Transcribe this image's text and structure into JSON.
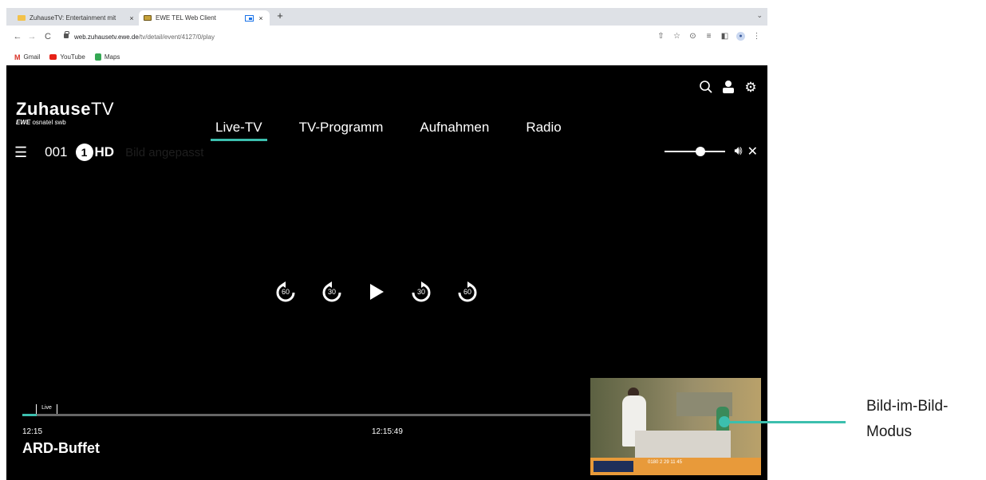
{
  "browser": {
    "tabs": [
      {
        "title": "ZuhauseTV: Entertainment mit",
        "active": false
      },
      {
        "title": "EWE TEL Web Client",
        "active": true
      }
    ],
    "new_tab": "+",
    "tab_close": "×",
    "url_host": "web.zuhausetv.ewe.de",
    "url_path": "/tv/detail/event/4127/0/play",
    "bookmarks": [
      "Gmail",
      "YouTube",
      "Maps"
    ]
  },
  "header": {
    "logo_bold": "Zuhause",
    "logo_thin": "TV",
    "logo_sub_brand": "EWE",
    "logo_sub_rest": "osnatel swb",
    "nav": [
      "Live-TV",
      "TV-Programm",
      "Aufnahmen",
      "Radio"
    ],
    "active_nav": "Live-TV"
  },
  "channel": {
    "menu_icon": "☰",
    "number": "001",
    "logo_one": "1",
    "logo_hd": "HD",
    "tooltip": "Bild angepasst"
  },
  "volume": {
    "level": 0.6
  },
  "controls": {
    "rewind_60": "60",
    "rewind_30": "30",
    "forward_30": "30",
    "forward_60": "60"
  },
  "timeline": {
    "live_label": "Live",
    "start_time": "12:15",
    "current_time": "12:15:49",
    "progress": 0.02
  },
  "program": {
    "title": "ARD-Buffet"
  },
  "pip": {
    "phone": "0180 2 29 11 45"
  },
  "annotation": {
    "line1": "Bild-im-Bild-",
    "line2": "Modus"
  },
  "colors": {
    "accent": "#3cbfae",
    "background": "#000000"
  }
}
